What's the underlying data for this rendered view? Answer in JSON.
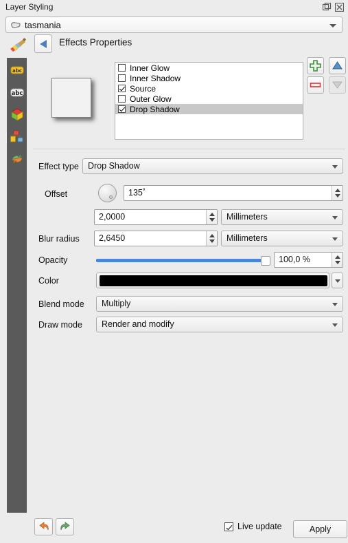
{
  "window": {
    "title": "Layer Styling",
    "float_icon": "float-window-icon",
    "close_icon": "close-icon"
  },
  "layer_selector": {
    "icon": "polygon-layer-icon",
    "value": "tasmania"
  },
  "header": {
    "brush_icon": "paintbrush-icon",
    "back_icon": "back-arrow-icon",
    "title": "Effects Properties"
  },
  "sidebar": {
    "items": [
      {
        "icon": "labels-abc-icon"
      },
      {
        "icon": "abc-buffer-icon"
      },
      {
        "icon": "symbology-cube-icon"
      },
      {
        "icon": "diagram-icon"
      },
      {
        "icon": "rendering-arrows-icon"
      }
    ]
  },
  "preview": {
    "label": "effect-preview"
  },
  "effects_list": {
    "items": [
      {
        "label": "Inner Glow",
        "checked": false,
        "selected": false
      },
      {
        "label": "Inner Shadow",
        "checked": false,
        "selected": false
      },
      {
        "label": "Source",
        "checked": true,
        "selected": false
      },
      {
        "label": "Outer Glow",
        "checked": false,
        "selected": false
      },
      {
        "label": "Drop Shadow",
        "checked": true,
        "selected": true
      }
    ]
  },
  "list_buttons": {
    "add": "add-effect-icon",
    "remove": "remove-effect-icon",
    "move_up": "move-up-icon",
    "move_down": "move-down-icon"
  },
  "form": {
    "effect_type": {
      "label": "Effect type",
      "value": "Drop Shadow"
    },
    "offset": {
      "label": "Offset",
      "angle": "135˚",
      "distance": "2,0000",
      "units": "Millimeters"
    },
    "blur_radius": {
      "label": "Blur radius",
      "value": "2,6450",
      "units": "Millimeters"
    },
    "opacity": {
      "label": "Opacity",
      "value": "100,0 %",
      "percent": 100
    },
    "color": {
      "label": "Color",
      "value": "#000000"
    },
    "blend_mode": {
      "label": "Blend mode",
      "value": "Multiply"
    },
    "draw_mode": {
      "label": "Draw mode",
      "value": "Render and modify"
    }
  },
  "footer": {
    "undo_icon": "undo-icon",
    "redo_icon": "redo-icon",
    "live_update_label": "Live update",
    "live_update_checked": true,
    "apply_label": "Apply"
  },
  "colors": {
    "panel_bg": "#ececec",
    "sidebar_bg": "#5a5a5a",
    "slider_blue": "#4a86d8",
    "selection_grey": "#c8c8c8",
    "add_green": "#4c9a4c",
    "remove_red": "#d44040",
    "arrow_blue": "#4a7fc1"
  }
}
